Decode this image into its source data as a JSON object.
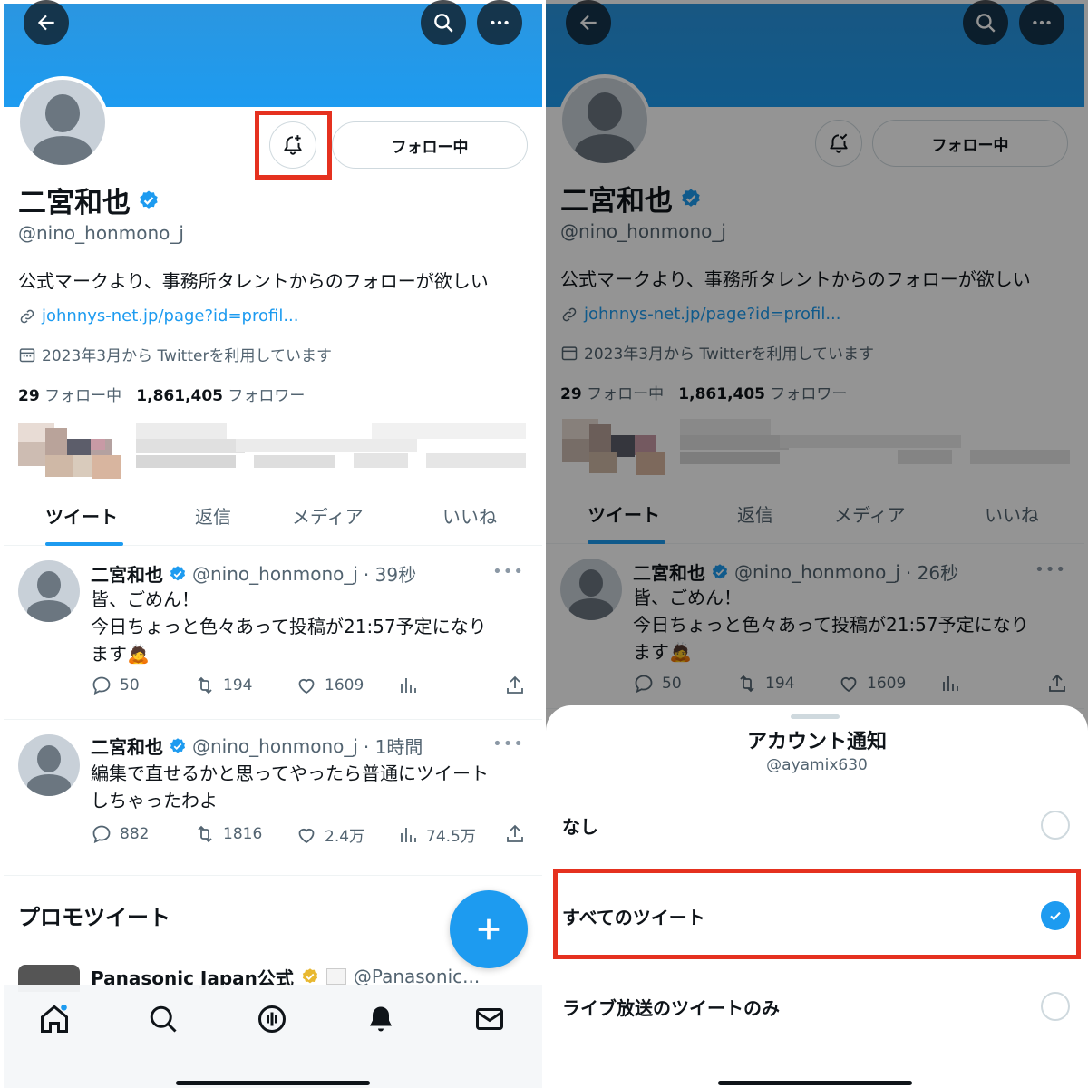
{
  "profile": {
    "name": "二宮和也",
    "handle": "@nino_honmono_j",
    "bio": "公式マークより、事務所タレントからのフォローが欲しい",
    "link": "johnnys-net.jp/page?id=profil...",
    "joined": "2023年3月から Twitterを利用しています",
    "following_count": "29",
    "following_label": "フォロー中",
    "followers_count": "1,861,405",
    "followers_label": "フォロワー",
    "follow_button": "フォロー中"
  },
  "tabs": [
    "ツイート",
    "返信",
    "メディア",
    "いいね"
  ],
  "tweets_left": [
    {
      "name": "二宮和也",
      "handle": "@nino_honmono_j",
      "time": "· 39秒",
      "lines": [
        "皆、ごめん！",
        "今日ちょっと色々あって投稿が21:57予定になり",
        "ます"
      ],
      "emoji": "🙇",
      "replies": "50",
      "retweets": "194",
      "likes": "1609",
      "views": ""
    },
    {
      "name": "二宮和也",
      "handle": "@nino_honmono_j",
      "time": "· 1時間",
      "lines": [
        "編集で直せるかと思ってやったら普通にツイート",
        "しちゃったわよ"
      ],
      "replies": "882",
      "retweets": "1816",
      "likes": "2.4万",
      "views": "74.5万"
    }
  ],
  "tweet_right": {
    "name": "二宮和也",
    "handle": "@nino_honmono_j",
    "time": "· 26秒",
    "lines": [
      "皆、ごめん！",
      "今日ちょっと色々あって投稿が21:57予定になり",
      "ます"
    ],
    "emoji": "🙇",
    "replies": "50",
    "retweets": "194",
    "likes": "1609"
  },
  "promo": {
    "title": "プロモツイート",
    "name": "Panasonic Japan公式",
    "handle": "@Panasonic..."
  },
  "sheet": {
    "title": "アカウント通知",
    "account": "@ayamix630",
    "options": [
      {
        "label": "なし",
        "selected": false
      },
      {
        "label": "すべてのツイート",
        "selected": true
      },
      {
        "label": "ライブ放送のツイートのみ",
        "selected": false
      }
    ]
  },
  "colors": {
    "accent": "#1d9bf0",
    "highlight": "#e5311f",
    "text": "#0f1419",
    "muted": "#536471"
  },
  "icons": [
    "back-arrow-icon",
    "search-icon",
    "more-icon",
    "bell-plus-icon",
    "bell-check-icon",
    "verified-icon",
    "link-icon",
    "calendar-icon",
    "reply-icon",
    "retweet-icon",
    "like-icon",
    "views-icon",
    "share-icon",
    "compose-plus-icon",
    "home-icon",
    "spaces-icon",
    "notifications-icon",
    "messages-icon"
  ]
}
